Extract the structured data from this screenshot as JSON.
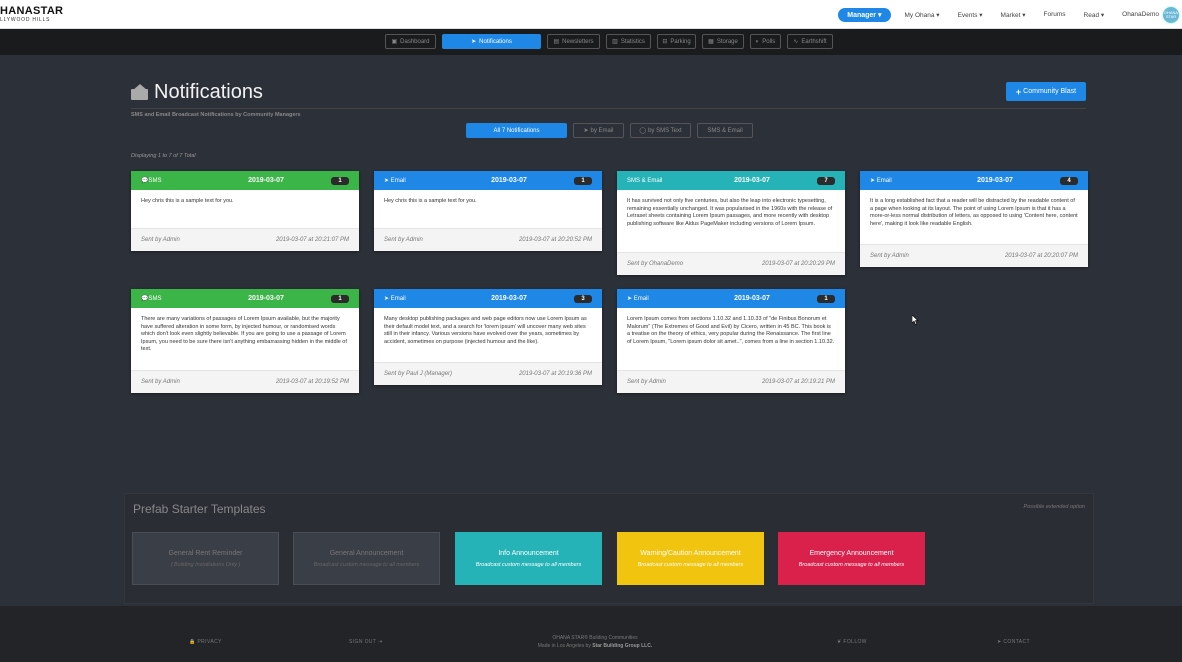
{
  "brand": {
    "line1": "HANASTAR",
    "line1_prefix": "O",
    "line2": "LLYWOOD HILLS"
  },
  "topnav": {
    "manager_label": "Manager",
    "links": [
      "My Ohana",
      "Events",
      "Market",
      "Forums",
      "Read"
    ],
    "user_name": "OhanaDemo",
    "avatar_text": "OHANA STAR"
  },
  "subnav": {
    "tabs": [
      "Dashboard",
      "Notifications",
      "Newsletters",
      "Statistics",
      "Parking",
      "Storage",
      "Polls",
      "Earthshift"
    ]
  },
  "page": {
    "title": "Notifications",
    "subtitle": "SMS and Email Broadcast Notifications by Community Managers",
    "blast_label": "Community Blast",
    "filters": [
      "All 7 Notifications",
      "by Email",
      "by SMS Text",
      "SMS & Email"
    ],
    "displaying": "Displaying 1 to 7 of 7 Total"
  },
  "cards": [
    {
      "type": "SMS",
      "date": "2019-03-07",
      "count": "1",
      "body": "Hey chris this is a sample text for you.",
      "sender": "Sent by Admin",
      "sent_at": "2019-03-07 at 20:21:07 PM",
      "color": "#3cb548"
    },
    {
      "type": "Email",
      "date": "2019-03-07",
      "count": "1",
      "body": "Hey chris this is a sample text for you.",
      "sender": "Sent by Admin",
      "sent_at": "2019-03-07 at 20:20:52 PM",
      "color": "#1f87e5"
    },
    {
      "type": "SMS & Email",
      "date": "2019-03-07",
      "count": "7",
      "body": "It has survived not only five centuries, but also the leap into electronic typesetting, remaining essentially unchanged. It was popularised in the 1960s with the release of Letraset sheets containing Lorem Ipsum passages, and more recently with desktop publishing software like Aldus PageMaker including versions of Lorem Ipsum.",
      "sender": "Sent by OhanaDemo",
      "sent_at": "2019-03-07 at 20:20:29 PM",
      "color": "#26b3b7"
    },
    {
      "type": "Email",
      "date": "2019-03-07",
      "count": "4",
      "body": "It is a long established fact that a reader will be distracted by the readable content of a page when looking at its layout. The point of using Lorem Ipsum is that it has a more-or-less normal distribution of letters, as opposed to using 'Content here, content here', making it look like readable English.",
      "sender": "Sent by Admin",
      "sent_at": "2019-03-07 at 20:20:07 PM",
      "color": "#1f87e5"
    },
    {
      "type": "SMS",
      "date": "2019-03-07",
      "count": "1",
      "body": "There are many variations of passages of Lorem Ipsum available, but the majority have suffered alteration in some form, by injected humour, or randomised words which don't look even slightly believable. If you are going to use a passage of Lorem Ipsum, you need to be sure there isn't anything embarrassing hidden in the middle of text.",
      "sender": "Sent by Admin",
      "sent_at": "2019-03-07 at 20:19:52 PM",
      "color": "#3cb548"
    },
    {
      "type": "Email",
      "date": "2019-03-07",
      "count": "3",
      "body": "Many desktop publishing packages and web page editors now use Lorem Ipsum as their default model text, and a search for 'lorem ipsum' will uncover many web sites still in their infancy. Various versions have evolved over the years, sometimes by accident, sometimes on purpose (injected humour and the like).",
      "sender": "Sent by Paul J (Manager)",
      "sent_at": "2019-03-07 at 20:19:36 PM",
      "color": "#1f87e5"
    },
    {
      "type": "Email",
      "date": "2019-03-07",
      "count": "1",
      "body": "Lorem Ipsum comes from sections 1.10.32 and 1.10.33 of \"de Finibus Bonorum et Malorum\" (The Extremes of Good and Evil) by Cicero, written in 45 BC. This book is a treatise on the theory of ethics, very popular during the Renaissance. The first line of Lorem Ipsum, \"Lorem ipsum dolor sit amet..\", comes from a line in section 1.10.32.",
      "sender": "Sent by Admin",
      "sent_at": "2019-03-07 at 20:19:21 PM",
      "color": "#1f87e5"
    }
  ],
  "templates": {
    "title": "Prefab Starter Templates",
    "note": "Possible extended option",
    "items": [
      {
        "name": "General Rent Reminder",
        "desc": "( Building Installations Only )"
      },
      {
        "name": "General Announcement",
        "desc": "Broadcast custom message to all members"
      },
      {
        "name": "Info Announcement",
        "desc": "Broadcast custom message to all members"
      },
      {
        "name": "Warning/Caution Announcement",
        "desc": "Broadcast custom message to all members"
      },
      {
        "name": "Emergency Announcement",
        "desc": "Broadcast custom message to all members"
      }
    ]
  },
  "footer": {
    "privacy": "PRIVACY",
    "signout": "SIGN OUT",
    "line1": "OHANA STAR® Building Communities",
    "line2_prefix": "Made in Los Angeles by",
    "line2_company": "Star Building Group LLC.",
    "follow": "FOLLOW",
    "contact": "CONTACT"
  }
}
